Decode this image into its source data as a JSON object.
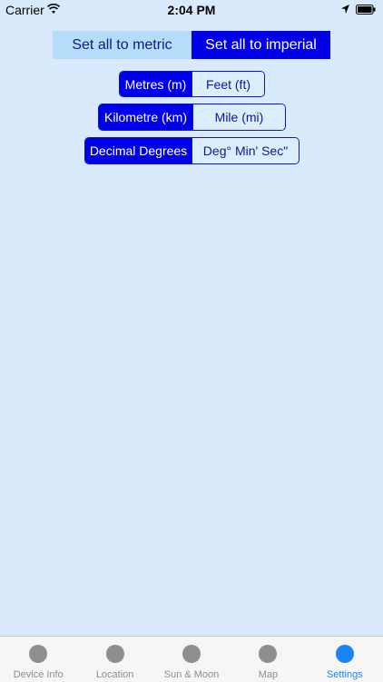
{
  "status_bar": {
    "carrier": "Carrier",
    "time": "2:04 PM"
  },
  "settings": {
    "set_metric_label": "Set all to metric",
    "set_imperial_label": "Set all to imperial",
    "length_units": {
      "selected": "Metres (m)",
      "other": "Feet (ft)"
    },
    "distance_units": {
      "selected": "Kilometre (km)",
      "other": "Mile (mi)"
    },
    "coordinate_format": {
      "selected": "Decimal Degrees",
      "other": "Deg° Min' Sec\""
    }
  },
  "tab_bar": {
    "tabs": [
      {
        "label": "Device Info",
        "icon": "circle-icon"
      },
      {
        "label": "Location",
        "icon": "circle-icon"
      },
      {
        "label": "Sun & Moon",
        "icon": "circle-icon"
      },
      {
        "label": "Map",
        "icon": "circle-icon"
      },
      {
        "label": "Settings",
        "icon": "circle-icon"
      }
    ],
    "active_tab": "Settings"
  },
  "colors": {
    "background": "#d8eafb",
    "selected_segment": "#0000e6",
    "metric_button": "#b5dcf9",
    "tab_active": "#1b84f7",
    "tab_inactive": "#8e8e8e"
  }
}
